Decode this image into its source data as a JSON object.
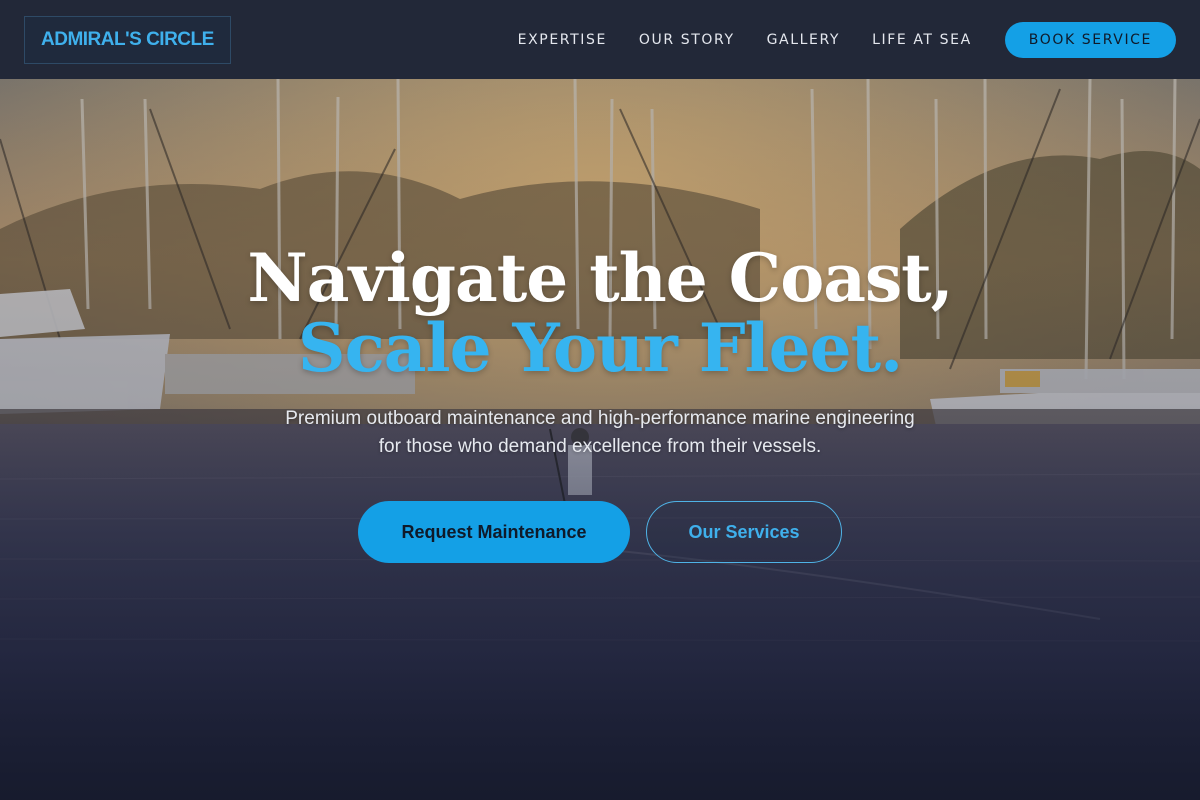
{
  "brand": {
    "logo_text": "ADMIRAL'S CIRCLE"
  },
  "nav": {
    "items": [
      {
        "label": "EXPERTISE"
      },
      {
        "label": "OUR STORY"
      },
      {
        "label": "GALLERY"
      },
      {
        "label": "LIFE AT SEA"
      }
    ],
    "cta_label": "BOOK SERVICE"
  },
  "hero": {
    "headline_line1": "Navigate the Coast,",
    "headline_line2": "Scale Your Fleet.",
    "subtitle": "Premium outboard maintenance and high-performance marine engineering for those who demand excellence from their vessels.",
    "primary_button": "Request Maintenance",
    "secondary_button": "Our Services"
  },
  "colors": {
    "accent": "#14a0e6",
    "accent_text": "#36b4f0",
    "nav_background": "#222838"
  }
}
